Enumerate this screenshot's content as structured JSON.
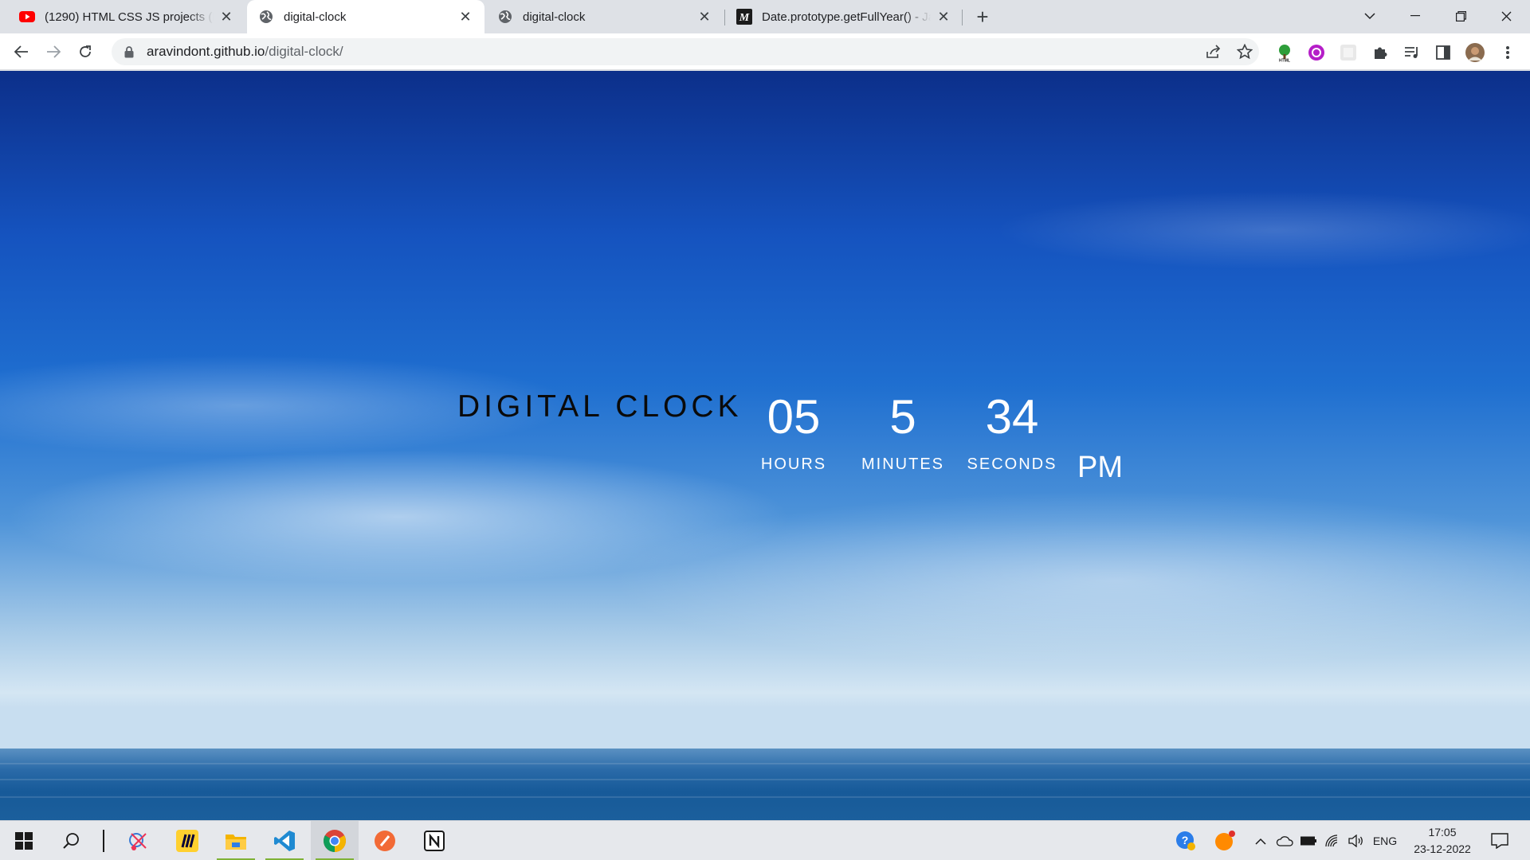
{
  "browser": {
    "tabs": [
      {
        "title": "(1290) HTML CSS JS projects (Beg",
        "icon": "youtube-icon",
        "active": false
      },
      {
        "title": "digital-clock",
        "icon": "globe-icon",
        "active": true
      },
      {
        "title": "digital-clock",
        "icon": "globe-icon",
        "active": false
      },
      {
        "title": "Date.prototype.getFullYear() - Jav",
        "icon": "mdn-icon",
        "active": false
      }
    ],
    "new_tab_label": "+",
    "url_host": "aravindont.github.io",
    "url_path": "/digital-clock/"
  },
  "page": {
    "title": "DIGITAL CLOCK",
    "hours": {
      "value": "05",
      "label": "HOURS"
    },
    "minutes": {
      "value": "5",
      "label": "MINUTES"
    },
    "seconds": {
      "value": "34",
      "label": "SECONDS"
    },
    "ampm": "PM"
  },
  "taskbar": {
    "apps": [
      "windows-start-icon",
      "search-icon",
      "snipping-tool-icon",
      "miro-icon",
      "file-explorer-icon",
      "vscode-icon",
      "chrome-icon",
      "paint-icon",
      "notion-icon"
    ],
    "language": "ENG",
    "time": "17:05",
    "date": "23-12-2022"
  },
  "colors": {
    "tab_strip": "#dee1e6",
    "youtube_red": "#ff0000",
    "chrome_green": "#7fb237",
    "clock_text": "#ffffff",
    "title_text": "#0a0a0a"
  }
}
